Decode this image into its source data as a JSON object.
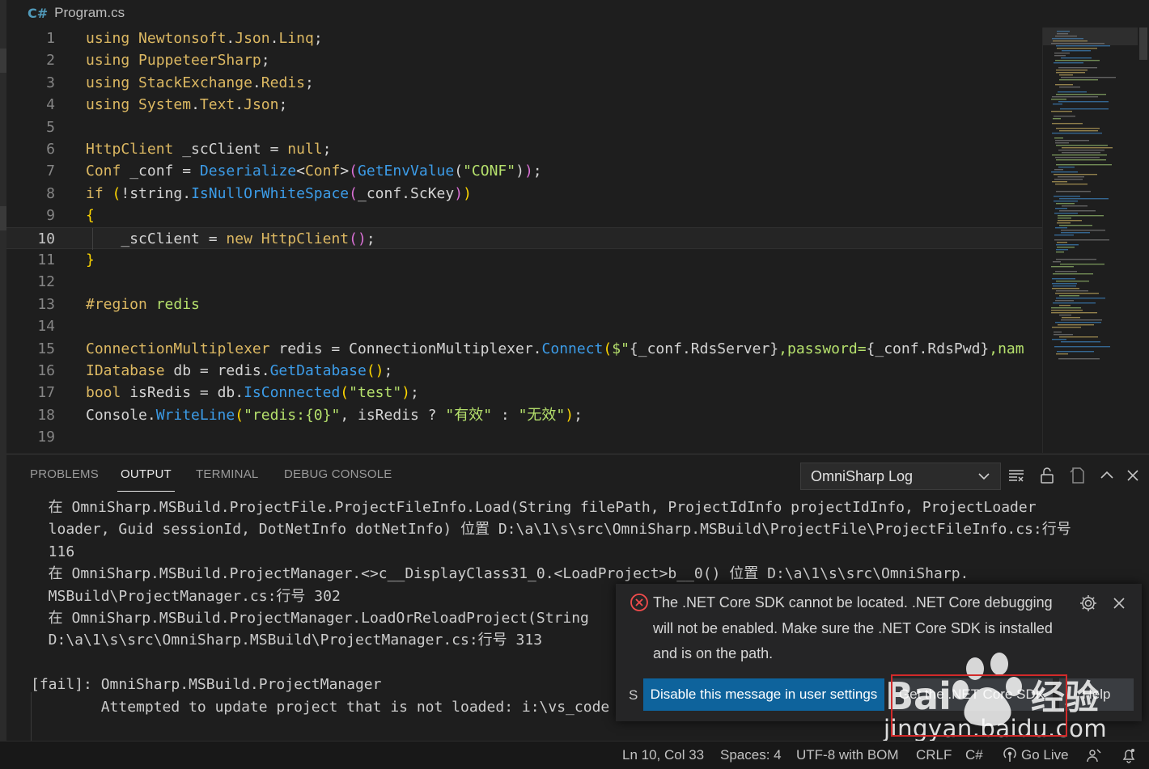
{
  "editor": {
    "file_name": "Program.cs",
    "current_line": "10",
    "lines": [
      {
        "num": "1",
        "tokens": [
          [
            "kw",
            "using"
          ],
          [
            "pl",
            " "
          ],
          [
            "ty",
            "Newtonsoft"
          ],
          [
            "pl",
            "."
          ],
          [
            "ty",
            "Json"
          ],
          [
            "pl",
            "."
          ],
          [
            "ty",
            "Linq"
          ],
          [
            "pl",
            ";"
          ]
        ]
      },
      {
        "num": "2",
        "tokens": [
          [
            "kw",
            "using"
          ],
          [
            "pl",
            " "
          ],
          [
            "ty",
            "PuppeteerSharp"
          ],
          [
            "pl",
            ";"
          ]
        ]
      },
      {
        "num": "3",
        "tokens": [
          [
            "kw",
            "using"
          ],
          [
            "pl",
            " "
          ],
          [
            "ty",
            "StackExchange"
          ],
          [
            "pl",
            "."
          ],
          [
            "ty",
            "Redis"
          ],
          [
            "pl",
            ";"
          ]
        ]
      },
      {
        "num": "4",
        "tokens": [
          [
            "kw",
            "using"
          ],
          [
            "pl",
            " "
          ],
          [
            "ty",
            "System"
          ],
          [
            "pl",
            "."
          ],
          [
            "ty",
            "Text"
          ],
          [
            "pl",
            "."
          ],
          [
            "ty",
            "Json"
          ],
          [
            "pl",
            ";"
          ]
        ]
      },
      {
        "num": "5",
        "tokens": []
      },
      {
        "num": "6",
        "tokens": [
          [
            "ty",
            "HttpClient"
          ],
          [
            "pl",
            " _scClient = "
          ],
          [
            "kw",
            "null"
          ],
          [
            "pl",
            ";"
          ]
        ]
      },
      {
        "num": "7",
        "tokens": [
          [
            "ty",
            "Conf"
          ],
          [
            "pl",
            " _conf = "
          ],
          [
            "fn",
            "Deserialize"
          ],
          [
            "pl",
            "<"
          ],
          [
            "ty",
            "Conf"
          ],
          [
            "pl",
            ">"
          ],
          [
            "br2",
            "("
          ],
          [
            "fn",
            "GetEnvValue"
          ],
          [
            "pl",
            "("
          ],
          [
            "str",
            "\"CONF\""
          ],
          [
            "pl",
            ")"
          ],
          [
            "br2",
            ")"
          ],
          [
            "pl",
            ";"
          ]
        ]
      },
      {
        "num": "8",
        "tokens": [
          [
            "kw",
            "if"
          ],
          [
            "pl",
            " "
          ],
          [
            "br1",
            "("
          ],
          [
            "pl",
            "!string."
          ],
          [
            "fn",
            "IsNullOrWhiteSpace"
          ],
          [
            "br2",
            "("
          ],
          [
            "pl",
            "_conf.ScKey"
          ],
          [
            "br2",
            ")"
          ],
          [
            "br1",
            ")"
          ]
        ]
      },
      {
        "num": "9",
        "tokens": [
          [
            "br1",
            "{"
          ]
        ]
      },
      {
        "num": "10",
        "tokens": [
          [
            "pl",
            "    _scClient = "
          ],
          [
            "kw",
            "new"
          ],
          [
            "pl",
            " "
          ],
          [
            "ty",
            "HttpClient"
          ],
          [
            "br2",
            "("
          ],
          [
            "br2",
            ")"
          ],
          [
            "pl",
            ";"
          ]
        ]
      },
      {
        "num": "11",
        "tokens": [
          [
            "br1",
            "}"
          ]
        ]
      },
      {
        "num": "12",
        "tokens": []
      },
      {
        "num": "13",
        "tokens": [
          [
            "kw",
            "#region"
          ],
          [
            "pl",
            " "
          ],
          [
            "str",
            "redis"
          ]
        ]
      },
      {
        "num": "14",
        "tokens": []
      },
      {
        "num": "15",
        "tokens": [
          [
            "ty",
            "ConnectionMultiplexer"
          ],
          [
            "pl",
            " redis = ConnectionMultiplexer."
          ],
          [
            "fn",
            "Connect"
          ],
          [
            "br1",
            "("
          ],
          [
            "str",
            "$\""
          ],
          [
            "pl",
            "{_conf.RdsServer}"
          ],
          [
            "str",
            ",password="
          ],
          [
            "pl",
            "{_conf.RdsPwd}"
          ],
          [
            "str",
            ",nam"
          ]
        ]
      },
      {
        "num": "16",
        "tokens": [
          [
            "ty",
            "IDatabase"
          ],
          [
            "pl",
            " db = redis."
          ],
          [
            "fn",
            "GetDatabase"
          ],
          [
            "br1",
            "("
          ],
          [
            "br1",
            ")"
          ],
          [
            "pl",
            ";"
          ]
        ]
      },
      {
        "num": "17",
        "tokens": [
          [
            "kw",
            "bool"
          ],
          [
            "pl",
            " isRedis = db."
          ],
          [
            "fn",
            "IsConnected"
          ],
          [
            "br1",
            "("
          ],
          [
            "str",
            "\"test\""
          ],
          [
            "br1",
            ")"
          ],
          [
            "pl",
            ";"
          ]
        ]
      },
      {
        "num": "18",
        "tokens": [
          [
            "pl",
            "Console."
          ],
          [
            "fn",
            "WriteLine"
          ],
          [
            "br1",
            "("
          ],
          [
            "str",
            "\"redis:{0}\""
          ],
          [
            "pl",
            ", isRedis ? "
          ],
          [
            "str",
            "\"有效\""
          ],
          [
            "pl",
            " : "
          ],
          [
            "str",
            "\"无效\""
          ],
          [
            "br1",
            ")"
          ],
          [
            "pl",
            ";"
          ]
        ]
      },
      {
        "num": "19",
        "tokens": []
      }
    ]
  },
  "panel": {
    "tabs": [
      "PROBLEMS",
      "OUTPUT",
      "TERMINAL",
      "DEBUG CONSOLE"
    ],
    "active_tab": "OUTPUT",
    "log_channel": "OmniSharp Log",
    "output_lines": [
      "  在 OmniSharp.MSBuild.ProjectFile.ProjectFileInfo.Load(String filePath, ProjectIdInfo projectIdInfo, ProjectLoader",
      "  loader, Guid sessionId, DotNetInfo dotNetInfo) 位置 D:\\a\\1\\s\\src\\OmniSharp.MSBuild\\ProjectFile\\ProjectFileInfo.cs:行号",
      "  116",
      "  在 OmniSharp.MSBuild.ProjectManager.<>c__DisplayClass31_0.<LoadProject>b__0() 位置 D:\\a\\1\\s\\src\\OmniSharp.",
      "  MSBuild\\ProjectManager.cs:行号 302",
      "  在 OmniSharp.MSBuild.ProjectManager.LoadOrReloadProject(String",
      "  D:\\a\\1\\s\\src\\OmniSharp.MSBuild\\ProjectManager.cs:行号 313",
      "",
      "[fail]: OmniSharp.MSBuild.ProjectManager",
      "        Attempted to update project that is not loaded: i:\\vs_code"
    ]
  },
  "notification": {
    "message": "The .NET Core SDK cannot be located. .NET Core debugging will not be enabled. Make sure the .NET Core SDK is installed and is on the path.",
    "source_letter": "S",
    "buttons": {
      "disable": "Disable this message in user settings",
      "get_sdk": "Get the .NET Core SDK",
      "help": "Help"
    }
  },
  "statusbar": {
    "position": "Ln 10, Col 33",
    "spaces": "Spaces: 4",
    "encoding": "UTF-8 with BOM",
    "eol": "CRLF",
    "language": "C#",
    "go_live": "Go Live"
  },
  "watermark": {
    "text": "jingyan.baidu.com"
  },
  "colors": {
    "accent_button": "#0e639c",
    "error_icon": "#f14c4c",
    "annotation_box": "#d22a2a"
  }
}
